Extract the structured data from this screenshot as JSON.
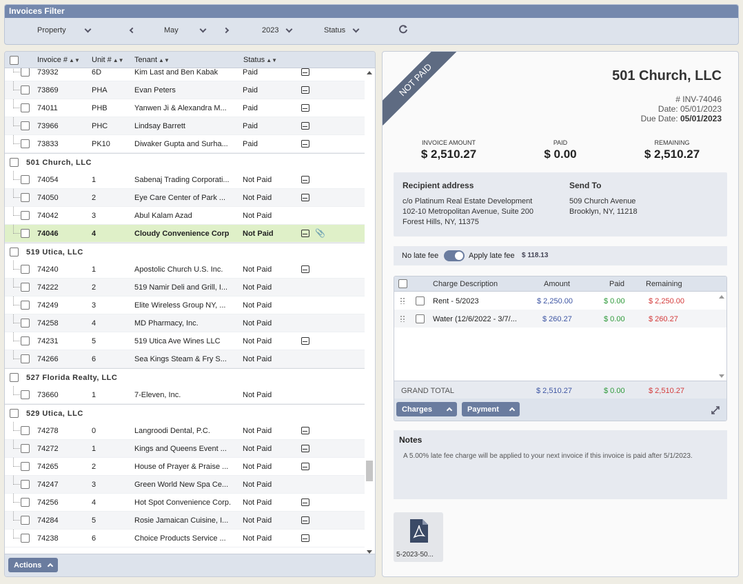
{
  "filter": {
    "title": "Invoices Filter",
    "property_label": "Property",
    "month": "May",
    "year": "2023",
    "status_label": "Status"
  },
  "grid": {
    "columns": {
      "invoice": "Invoice #",
      "unit": "Unit #",
      "tenant": "Tenant",
      "status": "Status"
    },
    "top_rows": [
      {
        "inv": "73932",
        "unit": "6D",
        "tenant": "Kim Last and Ben Kabak",
        "status": "Paid",
        "mail": true,
        "clip": false
      },
      {
        "inv": "73869",
        "unit": "PHA",
        "tenant": "Evan Peters",
        "status": "Paid",
        "mail": true,
        "clip": false
      },
      {
        "inv": "74011",
        "unit": "PHB",
        "tenant": "Yanwen Ji & Alexandra M...",
        "status": "Paid",
        "mail": true,
        "clip": false
      },
      {
        "inv": "73966",
        "unit": "PHC",
        "tenant": "Lindsay Barrett",
        "status": "Paid",
        "mail": true,
        "clip": false
      },
      {
        "inv": "73833",
        "unit": "PK10",
        "tenant": "Diwaker Gupta and Surha...",
        "status": "Paid",
        "mail": true,
        "clip": false
      }
    ],
    "groups": [
      {
        "name": "501 Church, LLC",
        "rows": [
          {
            "inv": "74054",
            "unit": "1",
            "tenant": "Sabenaj Trading Corporati...",
            "status": "Not Paid",
            "mail": true,
            "clip": false
          },
          {
            "inv": "74050",
            "unit": "2",
            "tenant": "Eye Care Center of Park ...",
            "status": "Not Paid",
            "mail": true,
            "clip": false
          },
          {
            "inv": "74042",
            "unit": "3",
            "tenant": "Abul Kalam Azad",
            "status": "Not Paid",
            "mail": false,
            "clip": false
          },
          {
            "inv": "74046",
            "unit": "4",
            "tenant": "Cloudy Convenience Corp",
            "status": "Not Paid",
            "mail": true,
            "clip": true,
            "selected": true
          }
        ]
      },
      {
        "name": "519 Utica, LLC",
        "rows": [
          {
            "inv": "74240",
            "unit": "1",
            "tenant": "Apostolic Church U.S. Inc.",
            "status": "Not Paid",
            "mail": true,
            "clip": false
          },
          {
            "inv": "74222",
            "unit": "2",
            "tenant": "519 Namir Deli and Grill, I...",
            "status": "Not Paid",
            "mail": false,
            "clip": false
          },
          {
            "inv": "74249",
            "unit": "3",
            "tenant": "Elite Wireless Group NY, ...",
            "status": "Not Paid",
            "mail": false,
            "clip": false
          },
          {
            "inv": "74258",
            "unit": "4",
            "tenant": "MD Pharmacy, Inc.",
            "status": "Not Paid",
            "mail": false,
            "clip": false
          },
          {
            "inv": "74231",
            "unit": "5",
            "tenant": "519 Utica Ave Wines LLC",
            "status": "Not Paid",
            "mail": true,
            "clip": false
          },
          {
            "inv": "74266",
            "unit": "6",
            "tenant": "Sea Kings Steam & Fry S...",
            "status": "Not Paid",
            "mail": false,
            "clip": false
          }
        ]
      },
      {
        "name": "527 Florida Realty, LLC",
        "rows": [
          {
            "inv": "73660",
            "unit": "1",
            "tenant": "7-Eleven, Inc.",
            "status": "Not Paid",
            "mail": false,
            "clip": false
          }
        ]
      },
      {
        "name": "529 Utica, LLC",
        "rows": [
          {
            "inv": "74278",
            "unit": "0",
            "tenant": "Langroodi Dental, P.C.",
            "status": "Not Paid",
            "mail": true,
            "clip": false
          },
          {
            "inv": "74272",
            "unit": "1",
            "tenant": "Kings and Queens Event ...",
            "status": "Not Paid",
            "mail": true,
            "clip": false
          },
          {
            "inv": "74265",
            "unit": "2",
            "tenant": "House of Prayer & Praise ...",
            "status": "Not Paid",
            "mail": true,
            "clip": false
          },
          {
            "inv": "74247",
            "unit": "3",
            "tenant": "Green World New Spa Ce...",
            "status": "Not Paid",
            "mail": false,
            "clip": false
          },
          {
            "inv": "74256",
            "unit": "4",
            "tenant": "Hot Spot Convenience Corp.",
            "status": "Not Paid",
            "mail": true,
            "clip": false
          },
          {
            "inv": "74284",
            "unit": "5",
            "tenant": "Rosie Jamaican Cuisine, I...",
            "status": "Not Paid",
            "mail": true,
            "clip": false
          },
          {
            "inv": "74238",
            "unit": "6",
            "tenant": "Choice Products Service ...",
            "status": "Not Paid",
            "mail": true,
            "clip": false
          }
        ]
      }
    ],
    "actions_label": "Actions"
  },
  "invoice": {
    "ribbon": "NOT PAID",
    "company": "501 Church, LLC",
    "number": "# INV-74046",
    "date_label": "Date:",
    "date": "05/01/2023",
    "due_label": "Due Date:",
    "due_date": "05/01/2023",
    "amount_label": "INVOICE AMOUNT",
    "amount": "$ 2,510.27",
    "paid_label": "PAID",
    "paid": "$ 0.00",
    "remaining_label": "REMAINING",
    "remaining": "$ 2,510.27",
    "recipient_heading": "Recipient address",
    "recipient_lines": [
      "c/o Platinum Real Estate Development",
      "102-10 Metropolitan Avenue, Suite 200",
      "Forest Hills, NY, 11375"
    ],
    "sendto_heading": "Send To",
    "sendto_lines": [
      "509 Church Avenue",
      "Brooklyn, NY, 11218"
    ],
    "no_late_fee": "No late fee",
    "apply_late_fee": "Apply late fee",
    "late_fee_amount": "$ 118.13"
  },
  "charges": {
    "columns": {
      "desc": "Charge Description",
      "amount": "Amount",
      "paid": "Paid",
      "remaining": "Remaining"
    },
    "rows": [
      {
        "desc": "Rent - 5/2023",
        "amount": "$ 2,250.00",
        "paid": "$ 0.00",
        "remaining": "$ 2,250.00"
      },
      {
        "desc": "Water (12/6/2022 - 3/7/...",
        "amount": "$ 260.27",
        "paid": "$ 0.00",
        "remaining": "$ 260.27"
      }
    ],
    "total_label": "GRAND TOTAL",
    "total_amount": "$ 2,510.27",
    "total_paid": "$ 0.00",
    "total_remaining": "$ 2,510.27",
    "charges_btn": "Charges",
    "payment_btn": "Payment"
  },
  "notes": {
    "heading": "Notes",
    "text": "A 5.00% late fee charge will be applied to your next invoice if this invoice is paid after 5/1/2023."
  },
  "attachment": {
    "name": "5-2023-50..."
  }
}
